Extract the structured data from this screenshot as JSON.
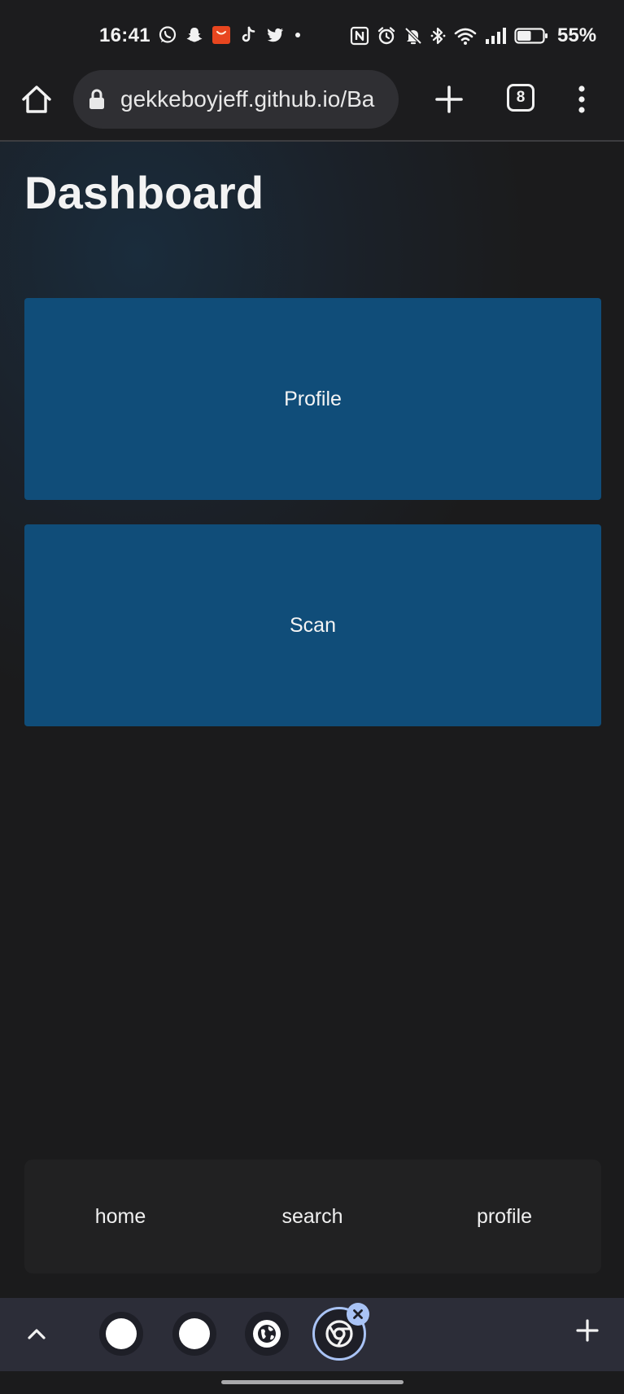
{
  "status_bar": {
    "time": "16:41",
    "app_icons": [
      "whatsapp-icon",
      "snapchat-icon",
      "aliexpress-icon",
      "tiktok-icon",
      "twitter-icon",
      "more-dot-icon"
    ],
    "system_icons": [
      "nfc-icon",
      "alarm-icon",
      "notifications-off-icon",
      "bluetooth-icon",
      "wifi-icon",
      "signal-icon",
      "battery-icon"
    ],
    "battery_percent": "55%",
    "battery_level": 0.55
  },
  "browser": {
    "url": "gekkeboyjeff.github.io/Ba",
    "tab_count": "8",
    "icons": {
      "home": "home-icon",
      "lock": "lock-icon",
      "new_tab": "plus-icon",
      "menu": "more-vert-icon"
    }
  },
  "page": {
    "title": "Dashboard",
    "tiles": [
      {
        "label": "Profile"
      },
      {
        "label": "Scan"
      }
    ],
    "bottom_nav": [
      {
        "label": "home"
      },
      {
        "label": "search"
      },
      {
        "label": "profile"
      }
    ]
  },
  "tab_strip": {
    "tabs": [
      "white-favicon",
      "white-favicon",
      "globe-favicon",
      "chrome-favicon"
    ],
    "active_tab_index": 3,
    "accent_color": "#a9c3f5"
  },
  "colors": {
    "tile": "#104d79",
    "background": "#1b1b1c",
    "nav_background": "#212122"
  }
}
